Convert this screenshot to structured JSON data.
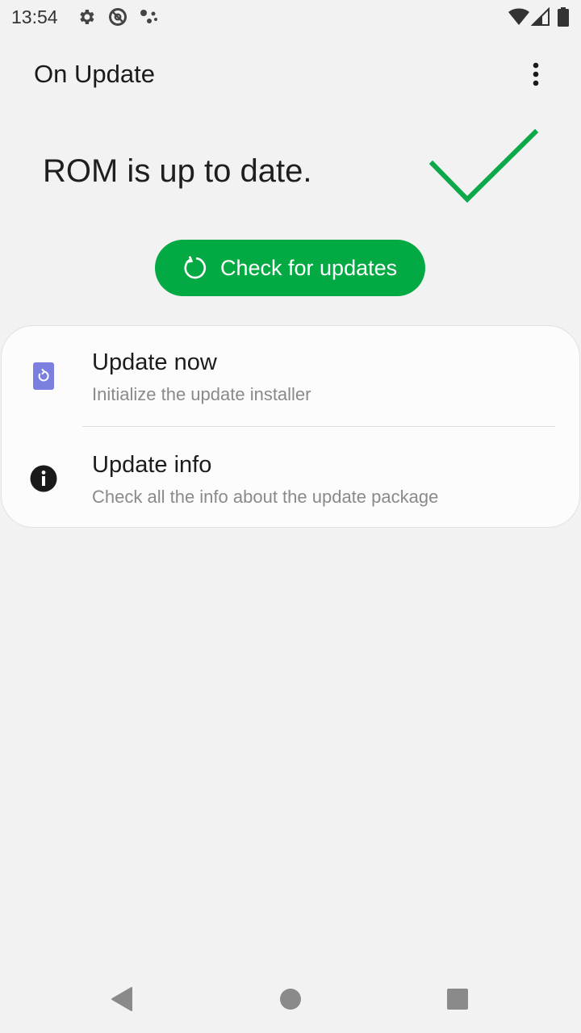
{
  "status_bar": {
    "time": "13:54",
    "icons": [
      "settings-icon",
      "do-not-disturb-icon",
      "assistant-icon",
      "wifi-icon",
      "signal-icon",
      "battery-icon"
    ]
  },
  "app_bar": {
    "title": "On Update",
    "menu_icon": "more-vert-icon"
  },
  "status": {
    "message": "ROM is up to date.",
    "icon": "check-icon",
    "icon_color": "#0da84a"
  },
  "check_button": {
    "label": "Check for updates",
    "icon": "refresh-icon",
    "color": "#03a943"
  },
  "options": [
    {
      "title": "Update now",
      "subtitle": "Initialize the update installer",
      "icon": "update-installer-icon",
      "icon_color": "#7b7fe0"
    },
    {
      "title": "Update info",
      "subtitle": "Check all the info about the update package",
      "icon": "info-icon",
      "icon_color": "#1a1a1a"
    }
  ],
  "nav_bar": {
    "buttons": [
      "back-icon",
      "home-icon",
      "recents-icon"
    ]
  }
}
